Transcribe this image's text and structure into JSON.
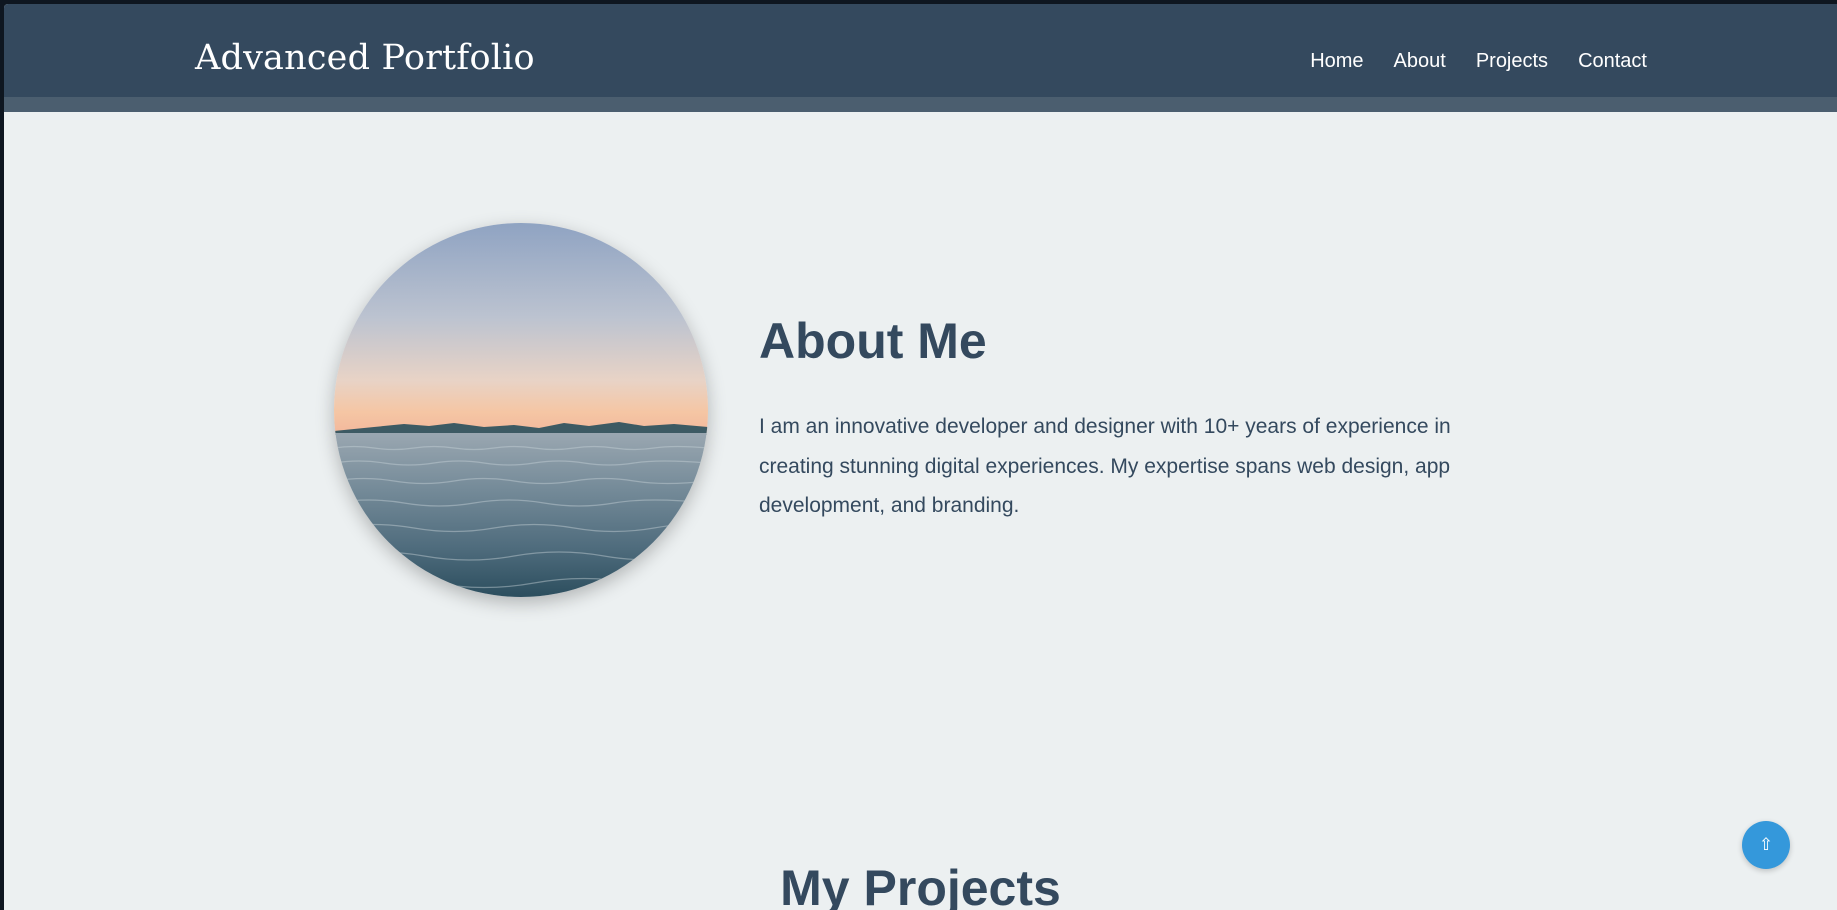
{
  "header": {
    "logo": "Advanced Portfolio",
    "nav": [
      {
        "label": "Home"
      },
      {
        "label": "About"
      },
      {
        "label": "Projects"
      },
      {
        "label": "Contact"
      }
    ]
  },
  "about": {
    "title": "About Me",
    "text": "I am an innovative developer and designer with 10+ years of experience in creating stunning digital experiences. My expertise spans web design, app development, and branding."
  },
  "projects": {
    "title": "My Projects"
  },
  "back_to_top": {
    "icon": "⇧"
  },
  "colors": {
    "header": "#34495e",
    "background": "#ecf0f1",
    "accent": "#3498db",
    "heading": "#34495e"
  }
}
